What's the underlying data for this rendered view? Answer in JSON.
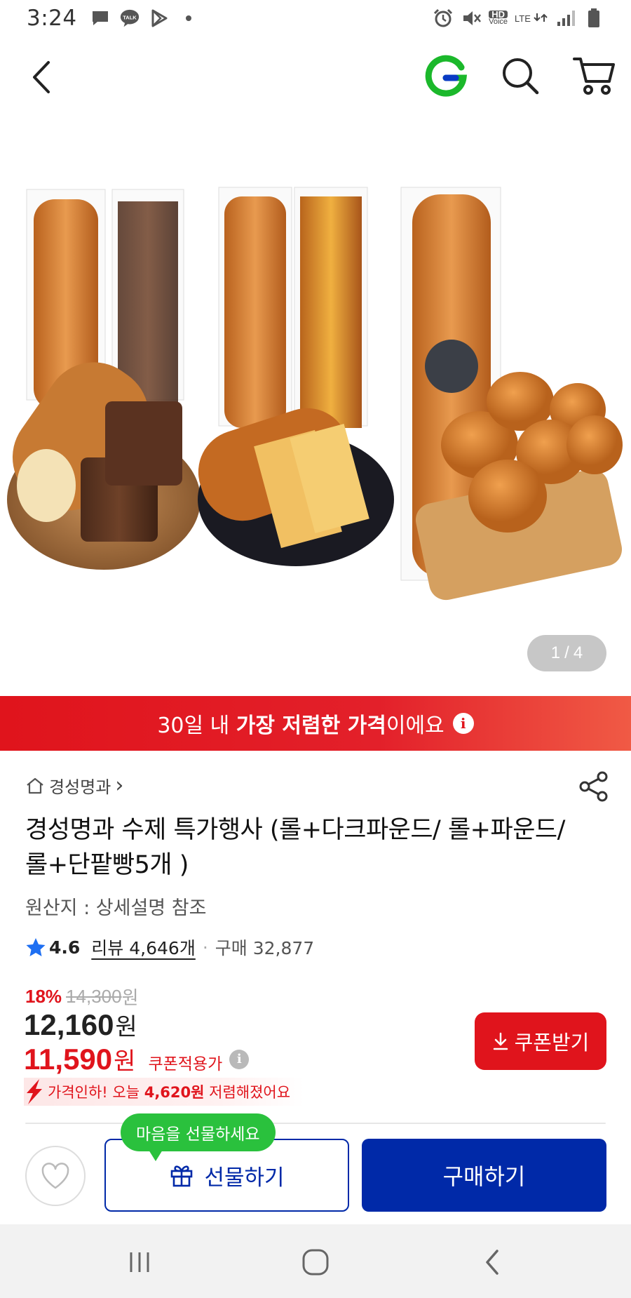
{
  "status_bar": {
    "time": "3:24",
    "left_icons": [
      "message-icon",
      "kakaotalk-icon",
      "play-store-icon",
      "dot-icon"
    ],
    "talk_badge": "TALK",
    "right_icons": [
      "alarm-icon",
      "mute-icon",
      "hd-voice-icon",
      "lte-icon",
      "signal-icon",
      "battery-icon"
    ],
    "hd_label": "HD",
    "voice_label": "Voice",
    "lte_label": "LTE"
  },
  "app_bar": {
    "back_icon": "chevron-left-icon",
    "logo_letter": "G",
    "search_icon": "search-icon",
    "cart_icon": "cart-icon"
  },
  "gallery": {
    "current": "1",
    "separator": "/",
    "total": "4"
  },
  "banner": {
    "prefix": "30일 내 ",
    "highlight": "가장 저렴한 가격",
    "suffix": "이에요",
    "info_glyph": "i",
    "color": "#e0141c"
  },
  "product": {
    "shop_name": "경성명과",
    "shop_chevron": "›",
    "title": "경성명과 수제 특가행사 (롤+다크파운드/ 롤+파운드/ 롤+단팥빵5개 )",
    "origin": "원산지 : 상세설명 참조",
    "rating": "4.6",
    "review_text": "리뷰 4,646개",
    "separator": "·",
    "purchase_text": "구매 32,877"
  },
  "price": {
    "discount_rate": "18%",
    "original_price": "14,300",
    "original_unit": "원",
    "sale_price": "12,160",
    "sale_unit": "원",
    "coupon_price": "11,590",
    "coupon_unit": "원",
    "coupon_label": "쿠폰적용가",
    "coupon_info_glyph": "i",
    "coupon_button": "쿠폰받기",
    "price_drop_prefix": "가격인하! 오늘 ",
    "price_drop_amount": "4,620원",
    "price_drop_suffix": " 저렴해졌어요"
  },
  "actions": {
    "gift_bubble": "마음을 선물하세요",
    "gift_button": "선물하기",
    "buy_button": "구매하기",
    "primary_color": "#0029a8",
    "bubble_color": "#2ac13d"
  },
  "nav_bar": {
    "buttons": [
      "recent-apps-icon",
      "home-icon",
      "back-icon"
    ]
  }
}
